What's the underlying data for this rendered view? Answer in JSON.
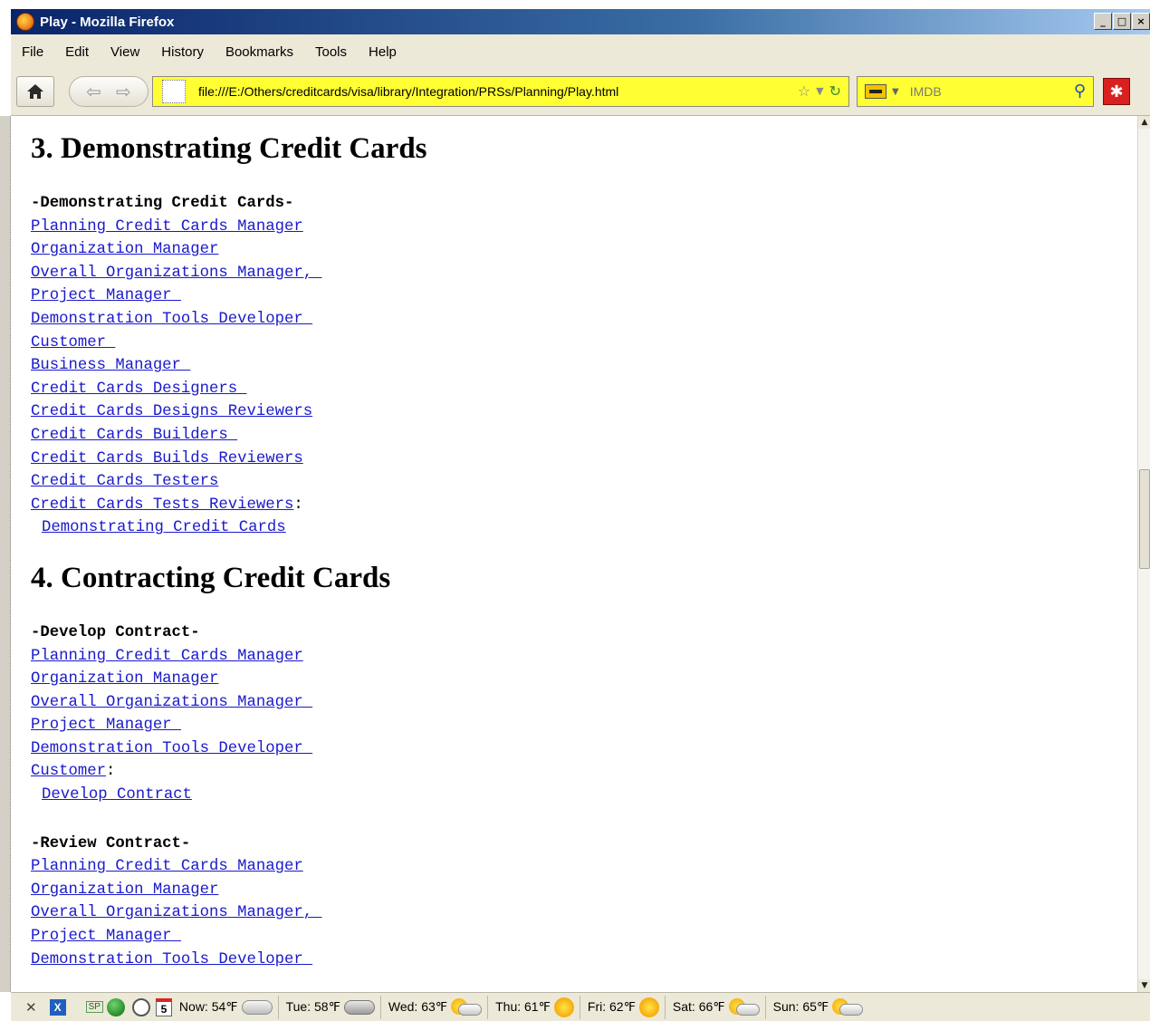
{
  "window": {
    "title": "Play - Mozilla Firefox",
    "min": "_",
    "max": "□",
    "close": "×"
  },
  "menu": [
    "File",
    "Edit",
    "View",
    "History",
    "Bookmarks",
    "Tools",
    "Help"
  ],
  "toolbar": {
    "url": "file:///E:/Others/creditcards/visa/library/Integration/PRSs/Planning/Play.html",
    "search_placeholder": "IMDB"
  },
  "page": {
    "sec3": {
      "title": "3. Demonstrating Credit Cards",
      "heading": "-Demonstrating Credit Cards-",
      "links": [
        "Planning Credit Cards Manager",
        "Organization Manager",
        "Overall Organizations Manager, ",
        "Project Manager ",
        "Demonstration Tools Developer ",
        "Customer ",
        "Business Manager ",
        "Credit Cards Designers ",
        "Credit Cards Designs Reviewers",
        "Credit Cards Builders ",
        "Credit Cards Builds Reviewers",
        "Credit Cards Testers",
        "Credit Cards Tests Reviewers"
      ],
      "colon": ":",
      "action": "Demonstrating Credit Cards"
    },
    "sec4": {
      "title": "4. Contracting Credit Cards",
      "develop": {
        "heading": "-Develop Contract-",
        "links": [
          "Planning Credit Cards Manager",
          "Organization Manager",
          "Overall Organizations Manager ",
          "Project Manager ",
          "Demonstration Tools Developer ",
          "Customer"
        ],
        "colon": ":",
        "action": "Develop Contract"
      },
      "review": {
        "heading": "-Review Contract-",
        "links": [
          "Planning Credit Cards Manager",
          "Organization Manager",
          "Overall Organizations Manager, ",
          "Project Manager ",
          "Demonstration Tools Developer "
        ]
      }
    }
  },
  "status": {
    "sp": "SP",
    "calendar_day": "5",
    "weather": [
      {
        "label": "Now: 54℉",
        "icon": "cloud"
      },
      {
        "label": "Tue: 58℉",
        "icon": "rain"
      },
      {
        "label": "Wed: 63℉",
        "icon": "partly"
      },
      {
        "label": "Thu: 61℉",
        "icon": "sun"
      },
      {
        "label": "Fri: 62℉",
        "icon": "sun"
      },
      {
        "label": "Sat: 66℉",
        "icon": "partly"
      },
      {
        "label": "Sun: 65℉",
        "icon": "partly"
      }
    ]
  }
}
